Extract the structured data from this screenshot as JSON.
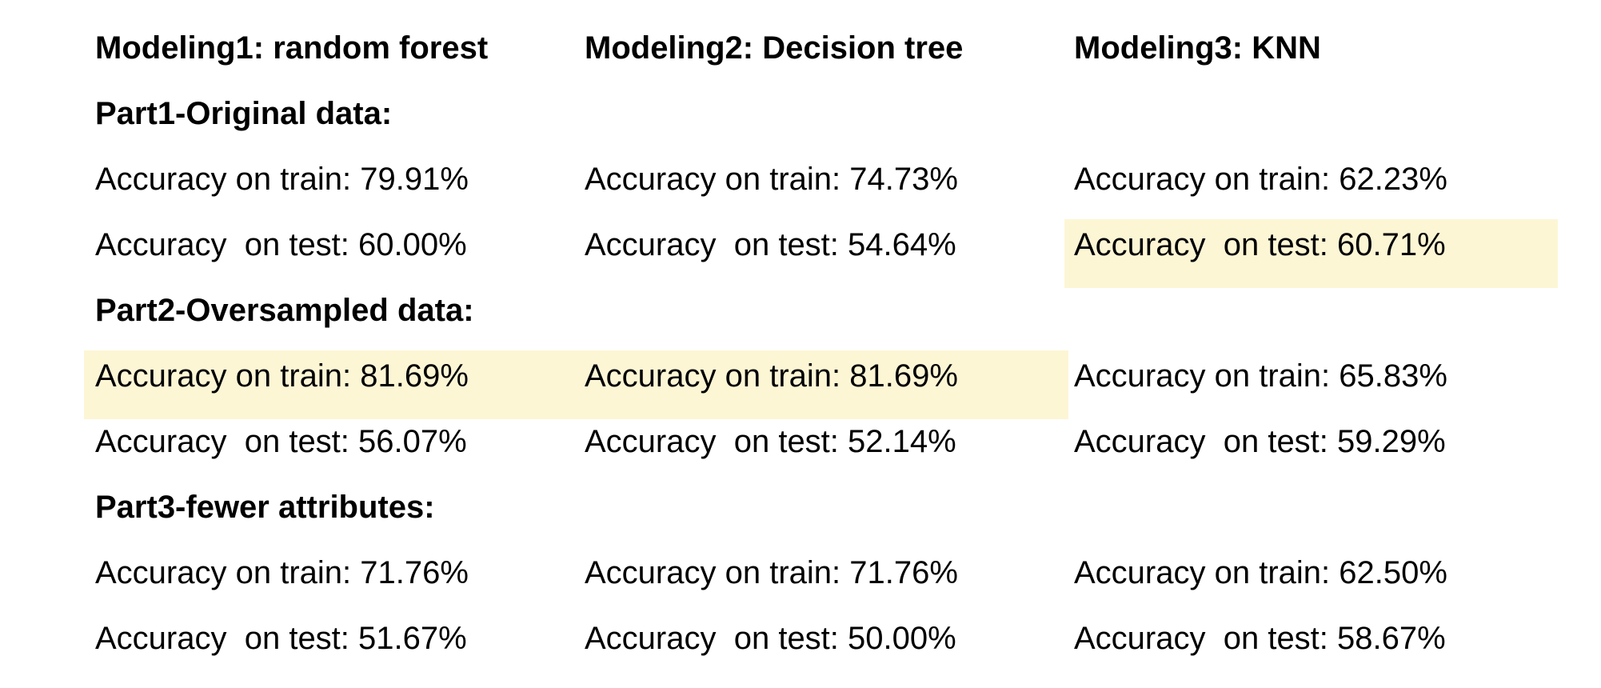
{
  "headers": [
    "Modeling1: random forest",
    "Modeling2: Decision tree",
    "Modeling3: KNN"
  ],
  "highlight_color": "#fdf6d5",
  "parts": [
    {
      "title": "Part1-Original data:",
      "rows": [
        [
          "Accuracy on train: 79.91%",
          "Accuracy on train: 74.73%",
          "Accuracy on train: 62.23%"
        ],
        [
          "Accuracy  on test: 60.00%",
          "Accuracy  on test: 54.64%",
          "Accuracy  on test: 60.71%"
        ]
      ]
    },
    {
      "title": "Part2-Oversampled data:",
      "rows": [
        [
          "Accuracy on train: 81.69%",
          "Accuracy on train: 81.69%",
          "Accuracy on train: 65.83%"
        ],
        [
          "Accuracy  on test: 56.07%",
          "Accuracy  on test: 52.14%",
          "Accuracy  on test: 59.29%"
        ]
      ]
    },
    {
      "title": "Part3-fewer attributes:",
      "rows": [
        [
          "Accuracy on train: 71.76%",
          "Accuracy on train: 71.76%",
          "Accuracy on train: 62.50%"
        ],
        [
          "Accuracy  on test: 51.67%",
          "Accuracy  on test: 50.00%",
          "Accuracy  on test: 58.67%"
        ]
      ]
    }
  ]
}
